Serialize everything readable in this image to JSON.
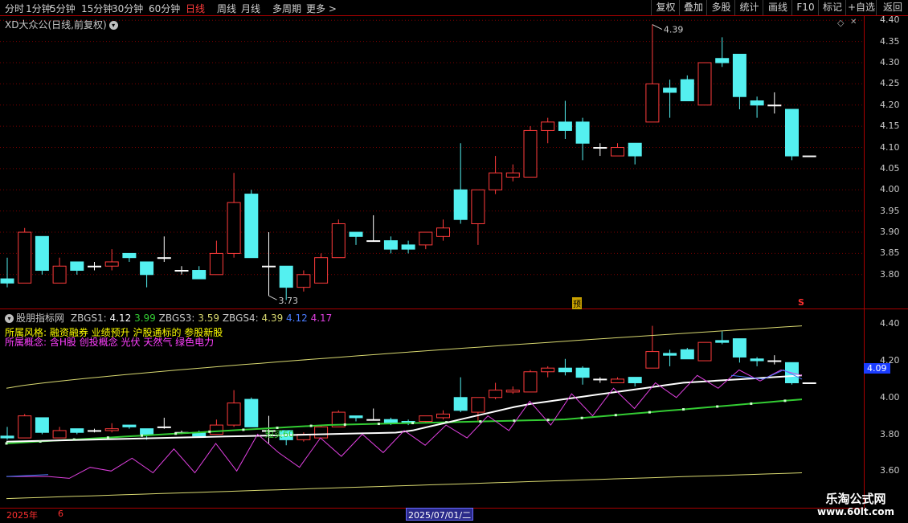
{
  "toolbar": {
    "periods": [
      "分时",
      "1分钟",
      "5分钟",
      "15分钟",
      "30分钟",
      "60分钟",
      "日线",
      "周线",
      "月线",
      "多周期",
      "更多 >"
    ],
    "active_period": "日线",
    "buttons": [
      "复权",
      "叠加",
      "多股",
      "统计",
      "画线",
      "F10",
      "标记",
      "+自选",
      "返回"
    ]
  },
  "stock": {
    "title": "XD大众公(日线,前复权)",
    "high_label": "4.39",
    "low_label": "3.73",
    "marker_yu": "预",
    "marker_s": "S"
  },
  "main_axis": [
    "4.40",
    "4.35",
    "4.30",
    "4.25",
    "4.20",
    "4.15",
    "4.10",
    "4.05",
    "4.00",
    "3.95",
    "3.90",
    "3.85",
    "3.80"
  ],
  "indicator": {
    "name": "股朋指标网",
    "z1_label": "ZBGS1:",
    "z1_value": "4.12",
    "z2_value": "3.99",
    "z3_label": "ZBGS3:",
    "z3_value": "3.59",
    "z4_label": "ZBGS4:",
    "z4_value": "4.39",
    "z5_value": "4.12",
    "z6_value": "4.17",
    "style_line": "所属风格: 融资融券 业绩预升 沪股通标的 参股新股",
    "concept_line": "所属概念: 含H股 创投概念 光伏 天然气 绿色电力",
    "short_buy_label": "短买60",
    "current_value": "4.09",
    "colors": {
      "white": "#ffffff",
      "green": "#33cc33",
      "magenta": "#e040e0",
      "blue": "#4a7cff",
      "yellow": "#d8d870"
    }
  },
  "ind_axis": [
    "4.40",
    "4.20",
    "4.00",
    "3.80",
    "3.60"
  ],
  "bottom": {
    "year": "2025年",
    "month": "6",
    "date_badge": "2025/07/01/二"
  },
  "watermark": {
    "line1": "乐淘公式网",
    "line2": "www.60lt.com"
  },
  "chart_data": {
    "type": "candlestick",
    "series": [
      {
        "open": 3.79,
        "close": 3.78,
        "high": 3.84,
        "low": 3.77
      },
      {
        "open": 3.78,
        "close": 3.9,
        "high": 3.91,
        "low": 3.78
      },
      {
        "open": 3.89,
        "close": 3.81,
        "high": 3.89,
        "low": 3.8
      },
      {
        "open": 3.78,
        "close": 3.82,
        "high": 3.84,
        "low": 3.78
      },
      {
        "open": 3.83,
        "close": 3.81,
        "high": 3.83,
        "low": 3.8
      },
      {
        "open": 3.82,
        "close": 3.82,
        "high": 3.83,
        "low": 3.81
      },
      {
        "open": 3.82,
        "close": 3.83,
        "high": 3.86,
        "low": 3.81
      },
      {
        "open": 3.85,
        "close": 3.84,
        "high": 3.85,
        "low": 3.83
      },
      {
        "open": 3.83,
        "close": 3.8,
        "high": 3.83,
        "low": 3.77
      },
      {
        "open": 3.84,
        "close": 3.84,
        "high": 3.89,
        "low": 3.83
      },
      {
        "open": 3.81,
        "close": 3.81,
        "high": 3.82,
        "low": 3.8
      },
      {
        "open": 3.81,
        "close": 3.79,
        "high": 3.82,
        "low": 3.79
      },
      {
        "open": 3.8,
        "close": 3.85,
        "high": 3.88,
        "low": 3.8
      },
      {
        "open": 3.85,
        "close": 3.97,
        "high": 4.04,
        "low": 3.84
      },
      {
        "open": 3.99,
        "close": 3.84,
        "high": 4.0,
        "low": 3.84
      },
      {
        "open": 3.82,
        "close": 3.82,
        "high": 3.9,
        "low": 3.75
      },
      {
        "open": 3.82,
        "close": 3.77,
        "high": 3.82,
        "low": 3.74
      },
      {
        "open": 3.77,
        "close": 3.8,
        "high": 3.81,
        "low": 3.76
      },
      {
        "open": 3.78,
        "close": 3.84,
        "high": 3.85,
        "low": 3.78
      },
      {
        "open": 3.84,
        "close": 3.92,
        "high": 3.93,
        "low": 3.84
      },
      {
        "open": 3.9,
        "close": 3.89,
        "high": 3.9,
        "low": 3.87
      },
      {
        "open": 3.88,
        "close": 3.88,
        "high": 3.94,
        "low": 3.88
      },
      {
        "open": 3.88,
        "close": 3.86,
        "high": 3.89,
        "low": 3.85
      },
      {
        "open": 3.87,
        "close": 3.86,
        "high": 3.88,
        "low": 3.85
      },
      {
        "open": 3.87,
        "close": 3.9,
        "high": 3.9,
        "low": 3.86
      },
      {
        "open": 3.89,
        "close": 3.91,
        "high": 3.93,
        "low": 3.88
      },
      {
        "open": 4.0,
        "close": 3.93,
        "high": 4.11,
        "low": 3.92
      },
      {
        "open": 3.92,
        "close": 4.0,
        "high": 4.0,
        "low": 3.87
      },
      {
        "open": 4.0,
        "close": 4.04,
        "high": 4.08,
        "low": 3.99
      },
      {
        "open": 4.03,
        "close": 4.04,
        "high": 4.06,
        "low": 4.02
      },
      {
        "open": 4.03,
        "close": 4.14,
        "high": 4.15,
        "low": 4.03
      },
      {
        "open": 4.14,
        "close": 4.16,
        "high": 4.17,
        "low": 4.11
      },
      {
        "open": 4.16,
        "close": 4.14,
        "high": 4.21,
        "low": 4.12
      },
      {
        "open": 4.16,
        "close": 4.11,
        "high": 4.17,
        "low": 4.07
      },
      {
        "open": 4.1,
        "close": 4.1,
        "high": 4.11,
        "low": 4.08
      },
      {
        "open": 4.08,
        "close": 4.1,
        "high": 4.11,
        "low": 4.08
      },
      {
        "open": 4.11,
        "close": 4.08,
        "high": 4.11,
        "low": 4.06
      },
      {
        "open": 4.16,
        "close": 4.25,
        "high": 4.39,
        "low": 4.16
      },
      {
        "open": 4.24,
        "close": 4.23,
        "high": 4.26,
        "low": 4.17
      },
      {
        "open": 4.26,
        "close": 4.21,
        "high": 4.27,
        "low": 4.21
      },
      {
        "open": 4.2,
        "close": 4.3,
        "high": 4.3,
        "low": 4.2
      },
      {
        "open": 4.31,
        "close": 4.3,
        "high": 4.36,
        "low": 4.29
      },
      {
        "open": 4.32,
        "close": 4.22,
        "high": 4.32,
        "low": 4.19
      },
      {
        "open": 4.21,
        "close": 4.2,
        "high": 4.22,
        "low": 4.17
      },
      {
        "open": 4.2,
        "close": 4.2,
        "high": 4.23,
        "low": 4.18
      },
      {
        "open": 4.19,
        "close": 4.08,
        "high": 4.19,
        "low": 4.07
      },
      {
        "open": 4.08,
        "close": 4.08,
        "high": 4.08,
        "low": 4.08
      }
    ],
    "ylim": [
      3.72,
      4.41
    ]
  }
}
